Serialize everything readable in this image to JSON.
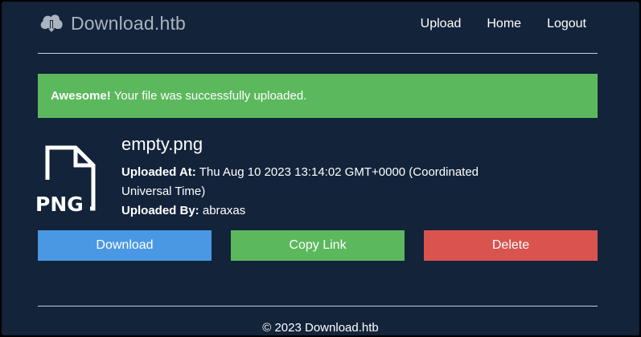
{
  "header": {
    "brand": "Download.htb",
    "brand_icon": "cloud-download-icon",
    "nav": [
      "Upload",
      "Home",
      "Logout"
    ]
  },
  "alert": {
    "strong": "Awesome!",
    "message": "Your file was successfully uploaded.",
    "color": "#5cb85c"
  },
  "file": {
    "icon": "png-file-icon",
    "icon_text": "PNG",
    "name": "empty.png",
    "uploaded_at_label": "Uploaded At:",
    "uploaded_at_value": "Thu Aug 10 2023 13:14:02 GMT+0000 (Coordinated Universal Time)",
    "uploaded_by_label": "Uploaded By:",
    "uploaded_by_value": "abraxas"
  },
  "actions": {
    "download": "Download",
    "copy_link": "Copy Link",
    "delete": "Delete"
  },
  "footer": {
    "copyright": "© 2023 Download.htb"
  },
  "colors": {
    "background": "#12233a",
    "download": "#4a98e4",
    "copy": "#5cb85c",
    "delete": "#d9534f"
  }
}
